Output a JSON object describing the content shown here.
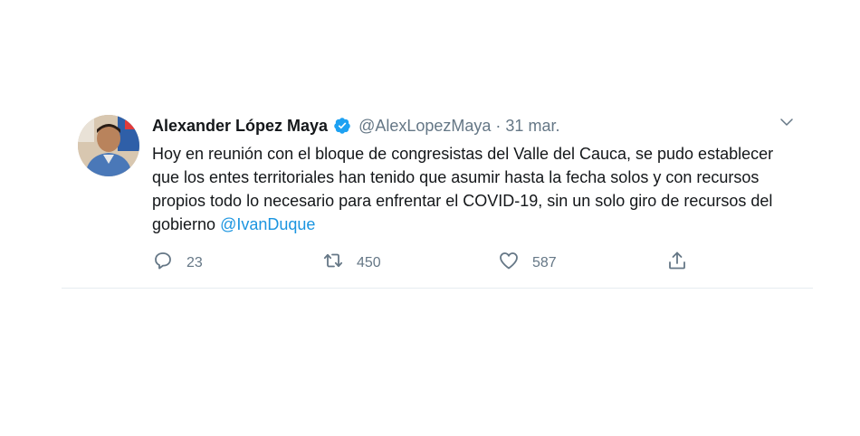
{
  "tweet": {
    "author_name": "Alexander López Maya",
    "handle": "@AlexLopezMaya",
    "separator": "·",
    "date": "31 mar.",
    "text": "Hoy en reunión con el bloque de congresistas del Valle del Cauca, se pudo establecer que los entes territoriales han tenido que asumir hasta la fecha solos y con recursos propios todo lo necesario para enfrentar el COVID-19, sin un solo giro de recursos del gobierno ",
    "mention": "@IvanDuque",
    "icons": {
      "avatar": "avatar",
      "verified": "verified-badge-icon",
      "menu": "chevron-down-icon",
      "reply": "reply-icon",
      "retweet": "retweet-icon",
      "like": "heart-icon",
      "share": "share-icon"
    }
  },
  "actions": {
    "replies": "23",
    "retweets": "450",
    "likes": "587"
  },
  "colors": {
    "text": "#14171a",
    "secondary": "#657786",
    "accent": "#1b95e0",
    "verified": "#1da1f2",
    "divider": "#e6ecf0"
  }
}
